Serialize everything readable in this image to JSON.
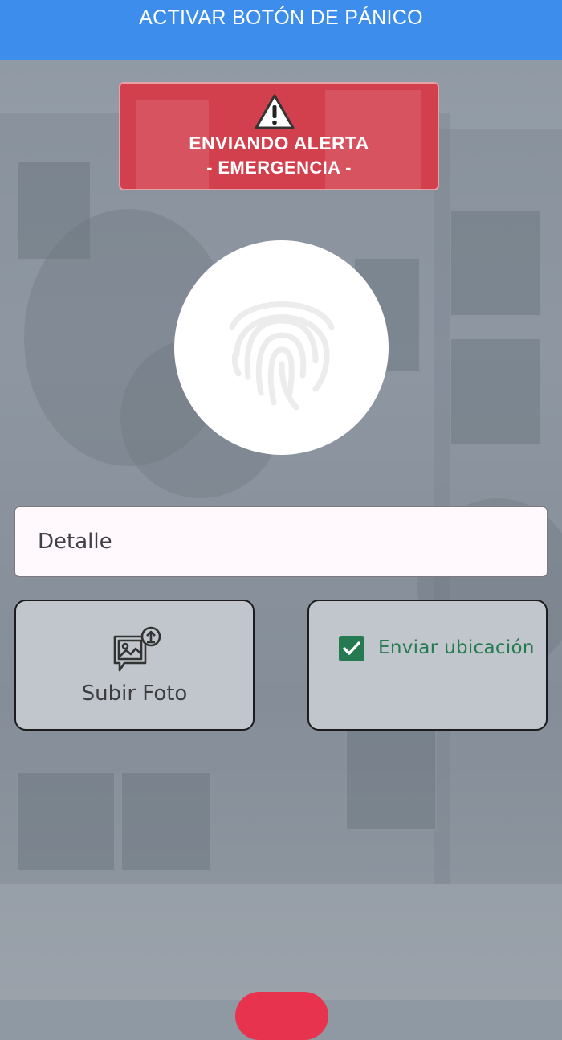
{
  "header": {
    "title": "ACTIVAR BOTÓN DE PÁNICO"
  },
  "alert_banner": {
    "line1": "ENVIANDO ALERTA",
    "line2": "- EMERGENCIA -",
    "icon": "warning-triangle-icon",
    "color": "#d2404d"
  },
  "panic_button": {
    "icon": "fingerprint-icon"
  },
  "detail": {
    "placeholder": "Detalle",
    "value": ""
  },
  "photo_card": {
    "label": "Subir Foto",
    "icon": "image-upload-icon"
  },
  "location_card": {
    "label": "Enviar ubicación",
    "checked": true,
    "accent": "#267a52"
  },
  "colors": {
    "header": "#3d8eec",
    "fab": "#e8334e"
  }
}
